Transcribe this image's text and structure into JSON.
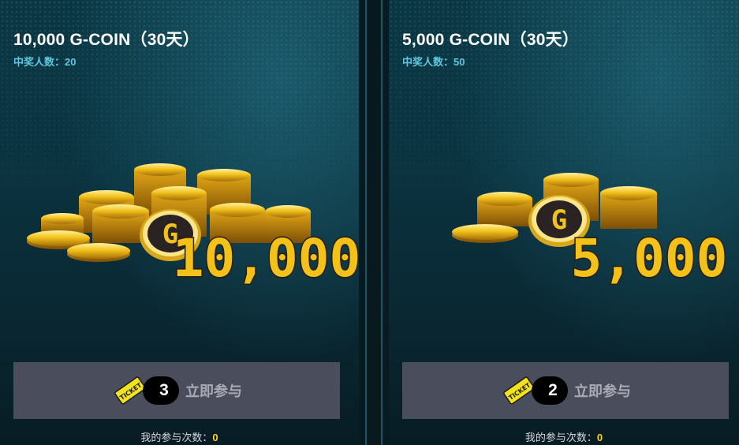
{
  "cards": [
    {
      "title": "10,000 G-COIN（30天）",
      "winners_label": "中奖人数：",
      "winners_count": "20",
      "amount_art": "10,000",
      "coin_letter": "G",
      "ticket_text": "TICKET",
      "ticket_cost": "3",
      "join_label": "立即参与",
      "participation_label": "我的参与次数：",
      "participation_count": "0"
    },
    {
      "title": "5,000 G-COIN（30天）",
      "winners_label": "中奖人数：",
      "winners_count": "50",
      "amount_art": "5,000",
      "coin_letter": "G",
      "ticket_text": "TICKET",
      "ticket_cost": "2",
      "join_label": "立即参与",
      "participation_label": "我的参与次数：",
      "participation_count": "0"
    }
  ],
  "colors": {
    "background": "#0b3441",
    "accent_cyan": "#5ec8e0",
    "button_bg": "#4a4d5c",
    "gold": "#f2c21b",
    "count_yellow": "#ffd21f"
  },
  "icons": [
    "coin-stack-icon",
    "g-coin-icon",
    "ticket-icon"
  ]
}
